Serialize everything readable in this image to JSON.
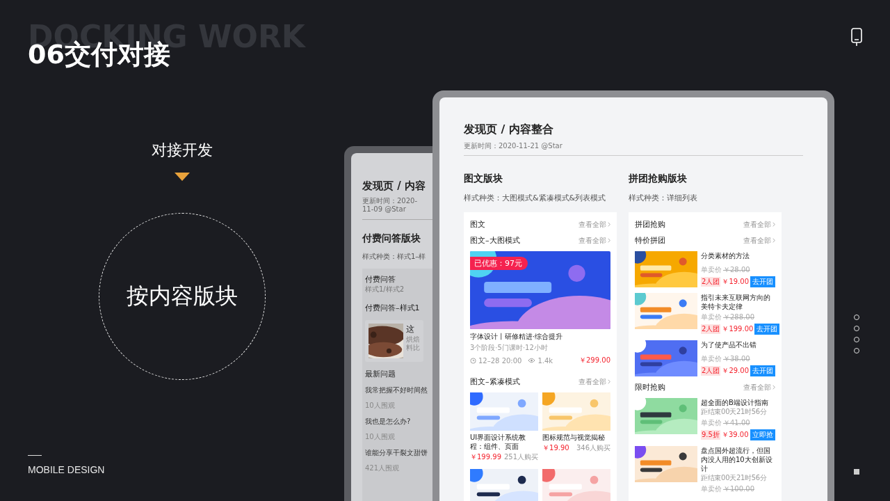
{
  "slide": {
    "ghost_title": "DOCKING WORK",
    "title": "06交付对接",
    "subtitle": "对接开发",
    "topic": "按内容版块",
    "footer": "MOBILE DESIGN"
  },
  "pager": [
    {
      "selected": false
    },
    {
      "selected": false
    },
    {
      "selected": false
    },
    {
      "selected": false
    }
  ],
  "back_screen": {
    "title": "发现页 / 内容",
    "meta": "更新时间：2020-11-09 @Star",
    "heading": "付费问答版块",
    "styles": "样式种类：样式1–样",
    "card": {
      "title": "付费问答",
      "subtitle": "样式1/样式2",
      "group": "付费问答–样式1",
      "post": {
        "title": "这",
        "lines": [
          "烘焙",
          "料比"
        ]
      },
      "latest": "最新问题",
      "questions": [
        {
          "text": "我常把握不好时间然",
          "views": "10人围观"
        },
        {
          "text": "我也是怎么办?",
          "views": "10人围观"
        },
        {
          "text": "谁能分享干裂文甜饼",
          "views": "421人围观"
        }
      ]
    }
  },
  "front_screen": {
    "title": "发现页 / 内容整合",
    "meta": "更新时间：2020-11-21 @Star",
    "left": {
      "heading": "图文版块",
      "styles": "样式种类：大图模式&紧凑模式&列表模式",
      "card_title": "图文",
      "more": "查看全部",
      "large": {
        "title": "图文–大图模式",
        "more": "查看全部",
        "badge": "已优惠：97元",
        "name": "字体设计丨研修精进·综合提升",
        "meta": "3个阶段·5门课时·12小时",
        "time": "12–28 20:00",
        "views": "1.4k",
        "price": "￥299.00"
      },
      "compact": {
        "title": "图文–紧凑模式",
        "more": "查看全部",
        "items": [
          {
            "kind": "course",
            "name": "UI界面设计系统教程：组件、页面",
            "price": "￥199.99",
            "sold": "251人购买"
          },
          {
            "kind": "course",
            "name": "图标规范与视觉揭秘",
            "price": "￥19.90",
            "sold": "346人购买"
          },
          {
            "kind": "picture"
          },
          {
            "kind": "picture"
          }
        ]
      }
    },
    "right": {
      "heading": "拼团抢购版块",
      "styles": "样式种类：详细列表",
      "card_title": "拼团抢购",
      "more": "查看全部",
      "groups": [
        {
          "title": "特价拼团",
          "more": "查看全部",
          "items": [
            {
              "name": "分类素材的方法",
              "label": "单卖价",
              "old_price": "￥28.00",
              "tag": "2人团",
              "price": "￥19.00",
              "button": "去开团"
            },
            {
              "name": "指引未来互联网方向的美特卡夫定律",
              "label": "单卖价",
              "old_price": "￥288.00",
              "tag": "2人团",
              "price": "￥199.00",
              "button": "去开团"
            },
            {
              "name": "为了使产品不出错",
              "label": "单卖价",
              "old_price": "￥38.00",
              "tag": "2人团",
              "price": "￥29.00",
              "button": "去开团"
            }
          ]
        },
        {
          "title": "限时抢购",
          "more": "查看全部",
          "items": [
            {
              "name": "超全面的B端设计指南",
              "countdown": "距结束00天21时56分",
              "label": "单卖价",
              "old_price": "￥41.00",
              "tag": "9.5折",
              "price": "￥39.00",
              "button": "立即抢"
            },
            {
              "name": "盘点国外超流行，但国内没人用的10大创新设计",
              "countdown": "距结束00天21时56分",
              "label": "单卖价",
              "old_price": "￥100.00"
            }
          ]
        }
      ]
    }
  }
}
